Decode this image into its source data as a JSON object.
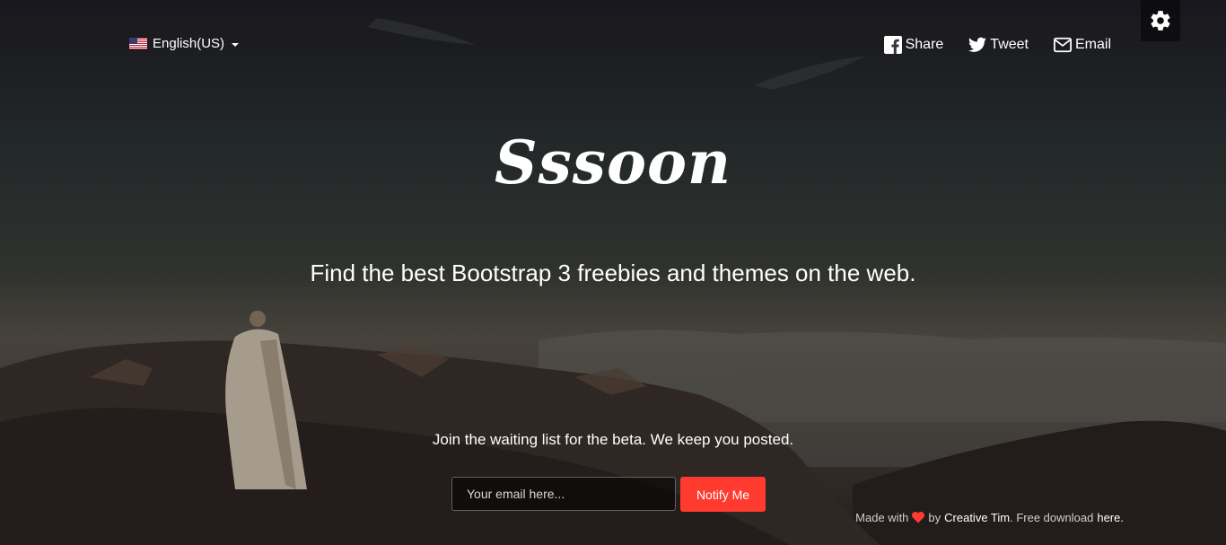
{
  "header": {
    "language": {
      "label": "English(US)",
      "flag_icon": "us-flag-icon"
    },
    "social": [
      {
        "label": "Share",
        "icon": "facebook-icon"
      },
      {
        "label": "Tweet",
        "icon": "twitter-icon"
      },
      {
        "label": "Email",
        "icon": "email-icon"
      }
    ],
    "settings_icon": "gear-icon"
  },
  "hero": {
    "logo": "Sssoon",
    "tagline": "Find the best Bootstrap 3 freebies and themes on the web.",
    "waitlist_text": "Join the waiting list for the beta. We keep you posted."
  },
  "signup": {
    "email_placeholder": "Your email here...",
    "email_value": "",
    "button_label": "Notify Me",
    "button_color": "#ff3b30"
  },
  "footer": {
    "made_with": "Made with",
    "heart_icon": "heart-icon",
    "by": "by",
    "author": "Creative Tim",
    "free_download": ". Free download",
    "here": "here",
    "end": "."
  },
  "colors": {
    "accent": "#ff3b30",
    "heart": "#ff3b30",
    "text": "#ffffff"
  }
}
